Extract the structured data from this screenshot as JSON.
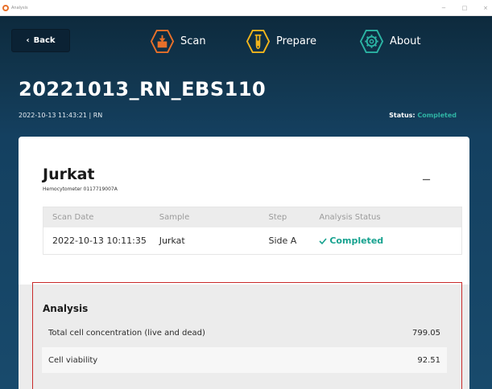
{
  "window": {
    "title": "Analysis",
    "minimize": "−",
    "maximize": "□",
    "close": "×"
  },
  "nav": {
    "back_label": "Back",
    "back_glyph": "‹",
    "scan_label": "Scan",
    "prepare_label": "Prepare",
    "about_label": "About",
    "icon_accent": "#e8702a",
    "prepare_accent": "#f1b51c",
    "about_accent": "#2bb3a3"
  },
  "run": {
    "title": "20221013_RN_EBS110",
    "meta": "2022-10-13 11:43:21 | RN",
    "status_label": "Status:",
    "status_value": "Completed",
    "status_color": "#2fb3a4"
  },
  "sample": {
    "name": "Jurkat",
    "subtitle": "Hemocytometer 0117719007A",
    "collapse_icon": "minus-icon"
  },
  "scan_table": {
    "headers": [
      "Scan Date",
      "Sample",
      "Step",
      "Analysis Status"
    ],
    "rows": [
      {
        "date": "2022-10-13 10:11:35",
        "sample": "Jurkat",
        "step": "Side A",
        "status": "Completed",
        "status_icon": "checkmark-icon"
      }
    ]
  },
  "analysis": {
    "title": "Analysis",
    "metrics": [
      {
        "label": "Total cell concentration (live and dead)",
        "value": "799.05"
      },
      {
        "label": "Cell viability",
        "value": "92.51"
      }
    ],
    "highlight_color": "#c92a2a"
  }
}
